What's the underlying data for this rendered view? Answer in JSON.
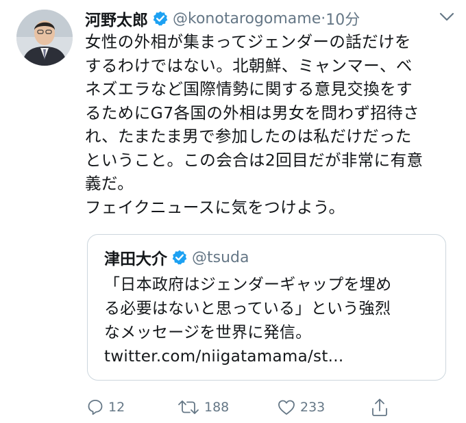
{
  "tweet": {
    "display_name": "河野太郎",
    "handle": "@konotarogomame",
    "separator": "·",
    "time": "10分",
    "body": "女性の外相が集まってジェンダーの話だけを\nするわけではない。北朝鮮、ミャンマー、ベ\nネズエラなど国際情勢に関する意見交換をす\nるためにG7各国の外相は男女を問わず招待さ\nれ、たまたま男で参加したのは私だけだった\nということ。この会合は2回目だが非常に有意\n義だ。\nフェイクニュースに気をつけよう。"
  },
  "quote": {
    "display_name": "津田大介",
    "handle": "@tsuda",
    "body": "「日本政府はジェンダーギャップを埋め\nる必要はないと思っている」という強烈\nなメッセージを世界に発信。",
    "link": "twitter.com/niigatamama/st..."
  },
  "actions": {
    "reply_count": "12",
    "retweet_count": "188",
    "like_count": "233"
  },
  "colors": {
    "verified": "#1da1f2",
    "muted": "#657786",
    "border": "#ccd6dd"
  },
  "icons": [
    "avatar",
    "verified-badge-icon",
    "chevron-down-icon",
    "reply-icon",
    "retweet-icon",
    "like-icon",
    "share-icon"
  ]
}
